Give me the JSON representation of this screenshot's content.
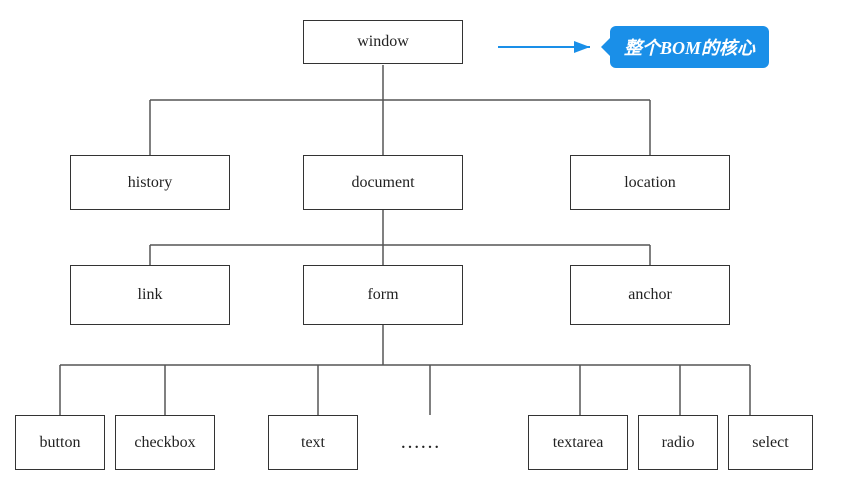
{
  "nodes": {
    "window": {
      "label": "window"
    },
    "history": {
      "label": "history"
    },
    "document": {
      "label": "document"
    },
    "location": {
      "label": "location"
    },
    "link": {
      "label": "link"
    },
    "form": {
      "label": "form"
    },
    "anchor": {
      "label": "anchor"
    },
    "button": {
      "label": "button"
    },
    "checkbox": {
      "label": "checkbox"
    },
    "text": {
      "label": "text"
    },
    "ellipsis": {
      "label": "……"
    },
    "textarea": {
      "label": "textarea"
    },
    "radio": {
      "label": "radio"
    },
    "select": {
      "label": "select"
    }
  },
  "callout": {
    "text": "整个BOM的核心"
  }
}
